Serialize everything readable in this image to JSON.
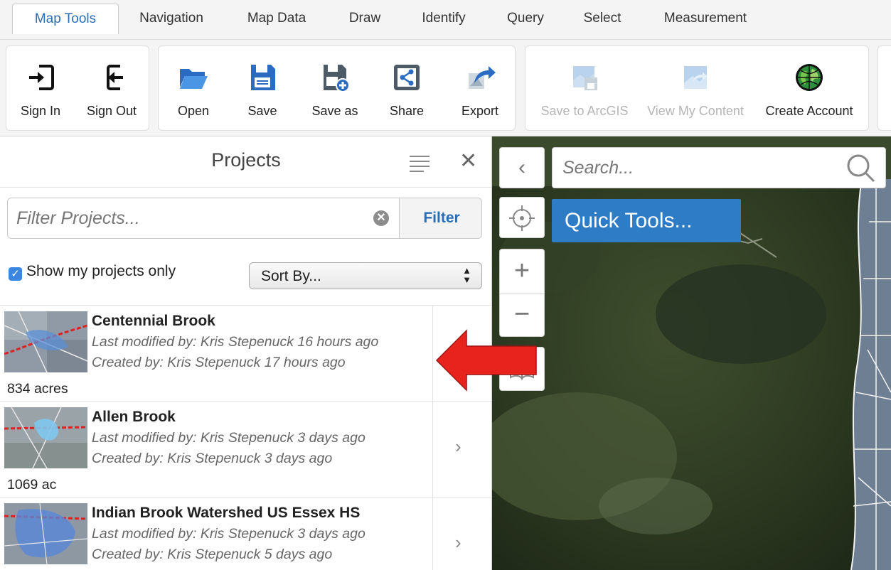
{
  "tabs": [
    "Map Tools",
    "Navigation",
    "Map Data",
    "Draw",
    "Identify",
    "Query",
    "Select",
    "Measurement"
  ],
  "active_tab": "Map Tools",
  "ribbon": {
    "sign_in": "Sign In",
    "sign_out": "Sign Out",
    "open": "Open",
    "save": "Save",
    "save_as": "Save as",
    "share": "Share",
    "export": "Export",
    "save_to_arcgis": "Save to ArcGIS",
    "view_my_content": "View My Content",
    "create_account": "Create Account"
  },
  "panel": {
    "title": "Projects",
    "filter_placeholder": "Filter Projects...",
    "filter_button": "Filter",
    "show_mine_label": "Show my projects only",
    "show_mine_checked": true,
    "sort_value": "Sort By...",
    "projects": [
      {
        "name": "Centennial Brook",
        "modified": "Last modified by: Kris Stepenuck 16 hours ago",
        "created": "Created by: Kris Stepenuck 17 hours ago",
        "area": "834 acres"
      },
      {
        "name": "Allen Brook",
        "modified": "Last modified by: Kris Stepenuck 3 days ago",
        "created": "Created by: Kris Stepenuck 3 days ago",
        "area": "1069 ac"
      },
      {
        "name": "Indian Brook Watershed US Essex HS",
        "modified": "Last modified by: Kris Stepenuck 3 days ago",
        "created": "Created by: Kris Stepenuck 5 days ago",
        "area": ""
      }
    ]
  },
  "map": {
    "search_placeholder": "Search...",
    "quick_tools": "Quick Tools..."
  },
  "colors": {
    "accent": "#2a6db4",
    "quick_tools_bg": "#2f7cc6",
    "arrow": "#e8221d",
    "checkbox": "#3a86e0"
  }
}
